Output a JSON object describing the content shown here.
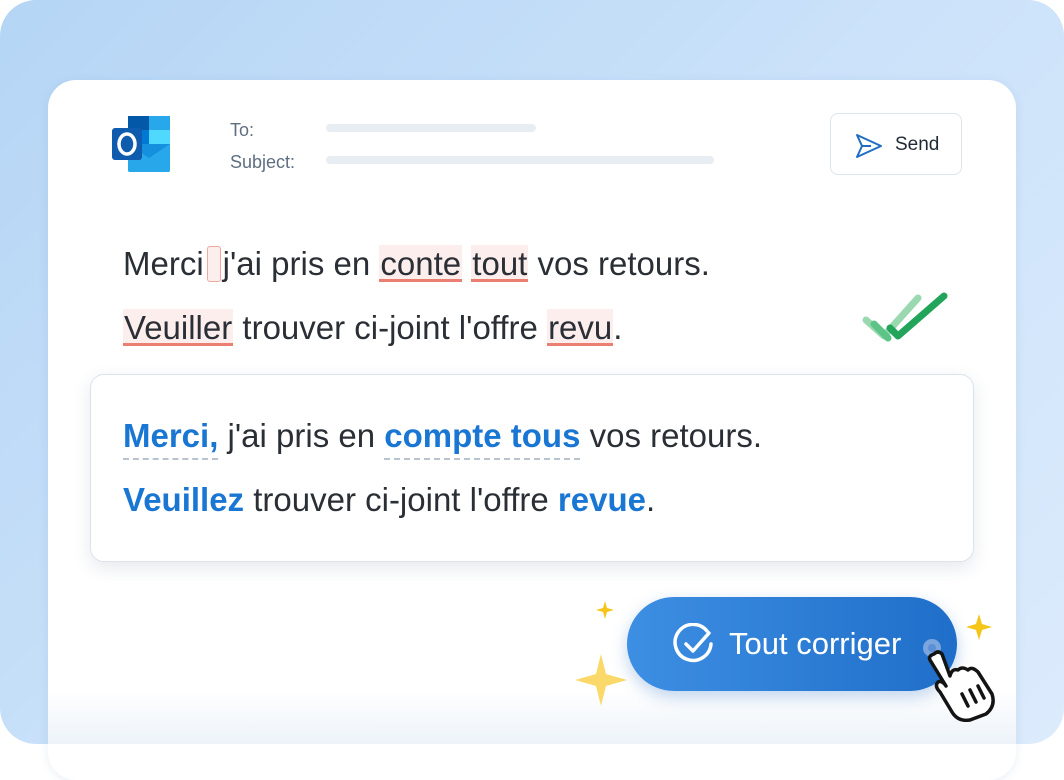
{
  "header": {
    "to_label": "To:",
    "subject_label": "Subject:",
    "send_label": "Send",
    "app_icon": "outlook-icon"
  },
  "original": {
    "line1": {
      "w1": "Merci",
      "t1": "j'ai pris en",
      "w2": "conte",
      "w3": "tout",
      "t2": "vos retours."
    },
    "line2": {
      "w1": "Veuiller",
      "t1": "trouver ci-joint l'offre",
      "w2": "revu",
      "t2": "."
    }
  },
  "corrected": {
    "line1": {
      "w1": "Merci,",
      "t1": "j'ai pris en",
      "w2": "compte tous",
      "t2": "vos retours."
    },
    "line2": {
      "w1": "Veuillez",
      "t1": "trouver ci-joint l'offre",
      "w2": "revue",
      "t2": "."
    }
  },
  "action": {
    "label": "Tout corriger",
    "icon": "check-circle-icon"
  },
  "colors": {
    "accent_blue": "#1976d2",
    "error_underline": "#ea7f72",
    "check_green": "#22a55a",
    "spark_yellow": "#f5c518"
  }
}
